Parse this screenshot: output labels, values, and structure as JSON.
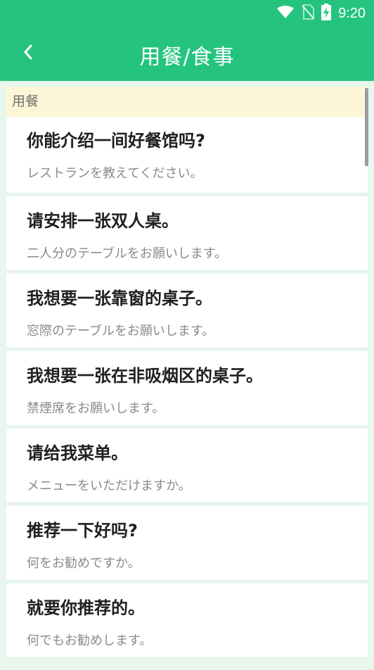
{
  "status_bar": {
    "time": "9:20"
  },
  "header": {
    "title": "用餐/食事"
  },
  "section": {
    "label": "用餐"
  },
  "phrases": [
    {
      "zh": "你能介绍一间好餐馆吗?",
      "ja": "レストランを教えてください。"
    },
    {
      "zh": "请安排一张双人桌。",
      "ja": "二人分のテーブルをお願いします。"
    },
    {
      "zh": "我想要一张靠窗的桌子。",
      "ja": "窓際のテーブルをお願いします。"
    },
    {
      "zh": "我想要一张在非吸烟区的桌子。",
      "ja": "禁煙席をお願いします。"
    },
    {
      "zh": "请给我菜单。",
      "ja": "メニューをいただけますか。"
    },
    {
      "zh": "推荐一下好吗?",
      "ja": "何をお勧めですか。"
    },
    {
      "zh": "就要你推荐的。",
      "ja": "何でもお勧めします。"
    }
  ],
  "colors": {
    "accent": "#24c47f",
    "section_bg": "#fdf6d6",
    "page_bg": "#e8f6ee"
  }
}
